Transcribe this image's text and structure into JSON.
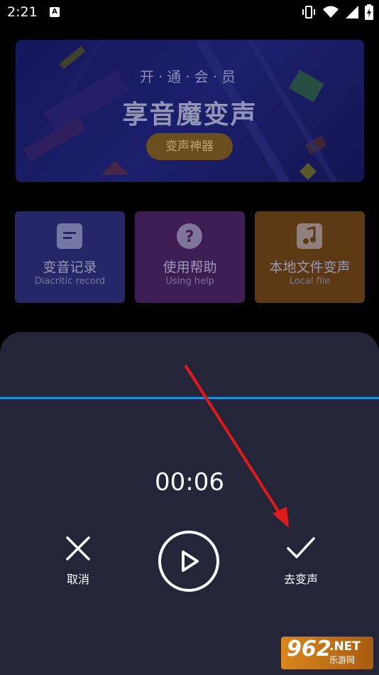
{
  "status_bar": {
    "time": "2:21",
    "notification_letter": "A"
  },
  "banner": {
    "subtitle": "开·通·会·员",
    "title": "享音魔变声",
    "button_label": "变声神器"
  },
  "tiles": [
    {
      "title": "变音记录",
      "subtitle": "Diacritic record",
      "icon": "document-icon",
      "color": "#252768"
    },
    {
      "title": "使用帮助",
      "subtitle": "Using help",
      "icon": "help-icon",
      "color": "#3e1d55"
    },
    {
      "title": "本地文件变声",
      "subtitle": "Local file",
      "icon": "music-icon",
      "color": "#5c3913"
    }
  ],
  "sheet": {
    "timer": "00:06",
    "cancel_label": "取消",
    "confirm_label": "去变声",
    "cancel_icon": "close-icon",
    "confirm_icon": "check-icon",
    "play_icon": "play-icon",
    "waveform_color": "#1a8fe0"
  },
  "watermark": {
    "number": "962",
    "suffix": ".NET",
    "text": "乐游网"
  }
}
